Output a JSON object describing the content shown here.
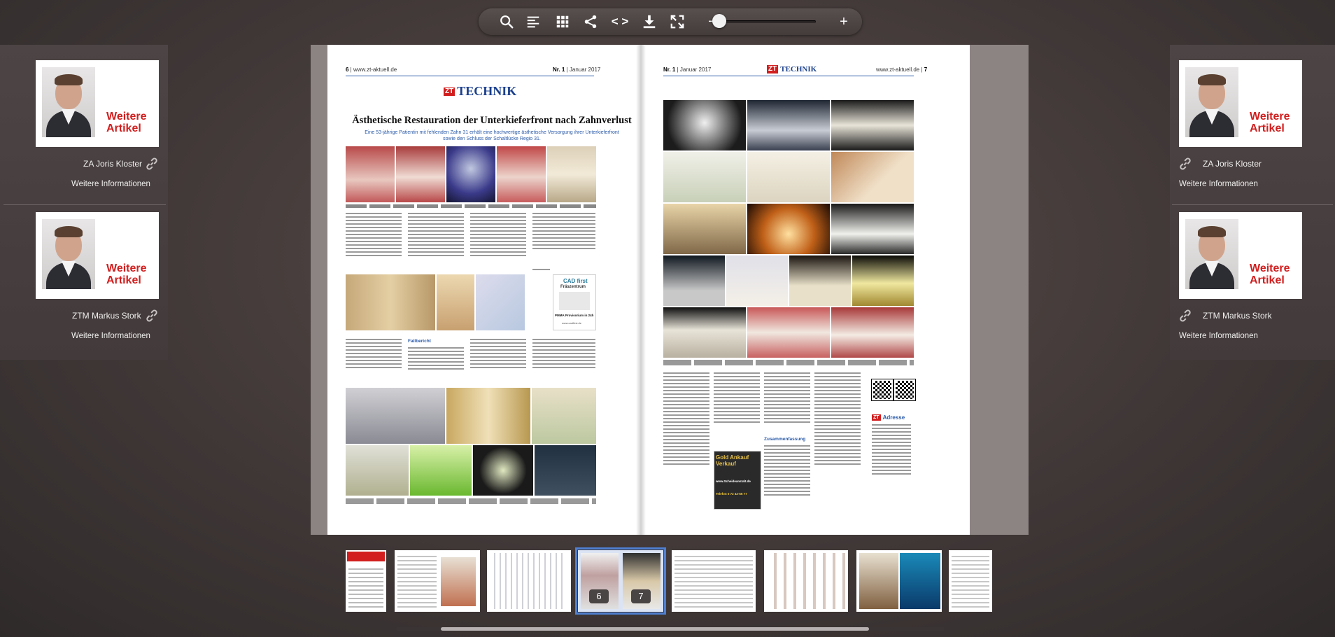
{
  "toolbar": {
    "buttons": [
      {
        "icon": "search-icon"
      },
      {
        "icon": "list-icon"
      },
      {
        "icon": "grid-icon"
      },
      {
        "icon": "share-icon"
      },
      {
        "icon": "code-icon",
        "label": "< >"
      },
      {
        "icon": "download-icon"
      },
      {
        "icon": "fullscreen-icon"
      }
    ],
    "zoom_out": "−",
    "zoom_in": "+",
    "zoom_level": 0.0
  },
  "sidebar_left": {
    "authors": [
      {
        "tag": "Weitere Artikel",
        "name": "ZA Joris Kloster",
        "more": "Weitere Informationen"
      },
      {
        "tag": "Weitere Artikel",
        "name": "ZTM Markus Stork",
        "more": "Weitere Informationen"
      }
    ]
  },
  "sidebar_right": {
    "authors": [
      {
        "tag": "Weitere Artikel",
        "name": "ZA Joris Kloster",
        "more": "Weitere Informationen"
      },
      {
        "tag": "Weitere Artikel",
        "name": "ZTM Markus Stork",
        "more": "Weitere Informationen"
      }
    ]
  },
  "nav": {
    "prev": "‹",
    "next": "›"
  },
  "page_left": {
    "page_no": "6",
    "url": "www.zt-aktuell.de",
    "issue": "Nr. 1",
    "month": "Januar 2017",
    "logo_zt": "ZT",
    "logo_text": "TECHNIK",
    "headline": "Ästhetische Restauration der Unterkieferfront nach Zahnverlust",
    "subhead": "Eine 53-jährige Patientin mit fehlenden Zahn 31 erhält eine hochwertige ästhetische Versorgung ihrer Unterkieferfront sowie den Schluss der Schaltlücke Regio 31.",
    "section_title": "Fallbericht",
    "ad_title": "CAD first",
    "ad_sub": "Fräszentrum",
    "ad_line": "PMMA Provisorium in 24h",
    "ad_url": "www.cadfirst.de"
  },
  "page_right": {
    "page_no": "7",
    "url": "www.zt-aktuell.de",
    "issue": "Nr. 1",
    "month": "Januar 2017",
    "logo_zt": "ZT",
    "logo_text": "TECHNIK",
    "section_title": "Zusammenfassung",
    "address_title": "Adresse",
    "ad_gold": "Gold Ankauf Verkauf",
    "ad_url": "www.Scheideanstalt.de",
    "ad_phone": "Telefon 0 72 42-55 77"
  },
  "thumbnails": [
    {
      "pages": "1"
    },
    {
      "pages": "2-3"
    },
    {
      "pages": "4-5"
    },
    {
      "pages": "6-7",
      "selected": true,
      "left_label": "6",
      "right_label": "7"
    },
    {
      "pages": "8-9"
    },
    {
      "pages": "10-11"
    },
    {
      "pages": "12-13"
    },
    {
      "pages": "14"
    }
  ],
  "colors": {
    "accent_red": "#d21e1e",
    "brand_blue": "#1a3f8c",
    "selection_blue": "#4e7fd0"
  }
}
